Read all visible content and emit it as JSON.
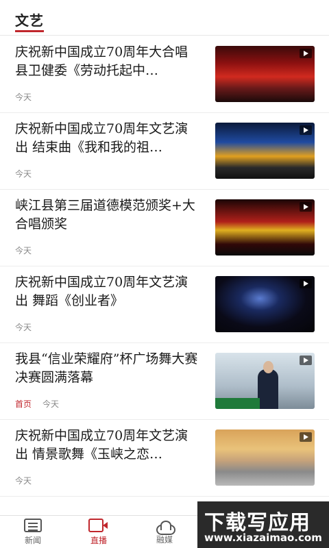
{
  "header": {
    "tab_label": "文艺"
  },
  "feed": [
    {
      "title": "庆祝新中国成立70周年大合唱 县卫健委《劳动托起中…",
      "tag": "",
      "time": "今天",
      "thumb": "th1"
    },
    {
      "title": "庆祝新中国成立70周年文艺演出 结束曲《我和我的祖…",
      "tag": "",
      "time": "今天",
      "thumb": "th2"
    },
    {
      "title": "峡江县第三届道德模范颁奖+大合唱颁奖",
      "tag": "",
      "time": "今天",
      "thumb": "th3"
    },
    {
      "title": "庆祝新中国成立70周年文艺演出 舞蹈《创业者》",
      "tag": "",
      "time": "今天",
      "thumb": "th4"
    },
    {
      "title": "我县“信业荣耀府”杯广场舞大赛决赛圆满落幕",
      "tag": "首页",
      "time": "今天",
      "thumb": "th5"
    },
    {
      "title": "庆祝新中国成立70周年文艺演出 情景歌舞《玉峡之恋…",
      "tag": "",
      "time": "今天",
      "thumb": "th6"
    }
  ],
  "bottom_nav": [
    {
      "label": "新闻",
      "icon": "news-icon"
    },
    {
      "label": "直播",
      "icon": "live-camera-icon",
      "active": true
    },
    {
      "label": "融媒",
      "icon": "cloud-icon"
    }
  ],
  "watermark": {
    "main": "下载写应用",
    "url": "www.xiazaimao.com"
  },
  "colors": {
    "accent": "#c0262c"
  }
}
